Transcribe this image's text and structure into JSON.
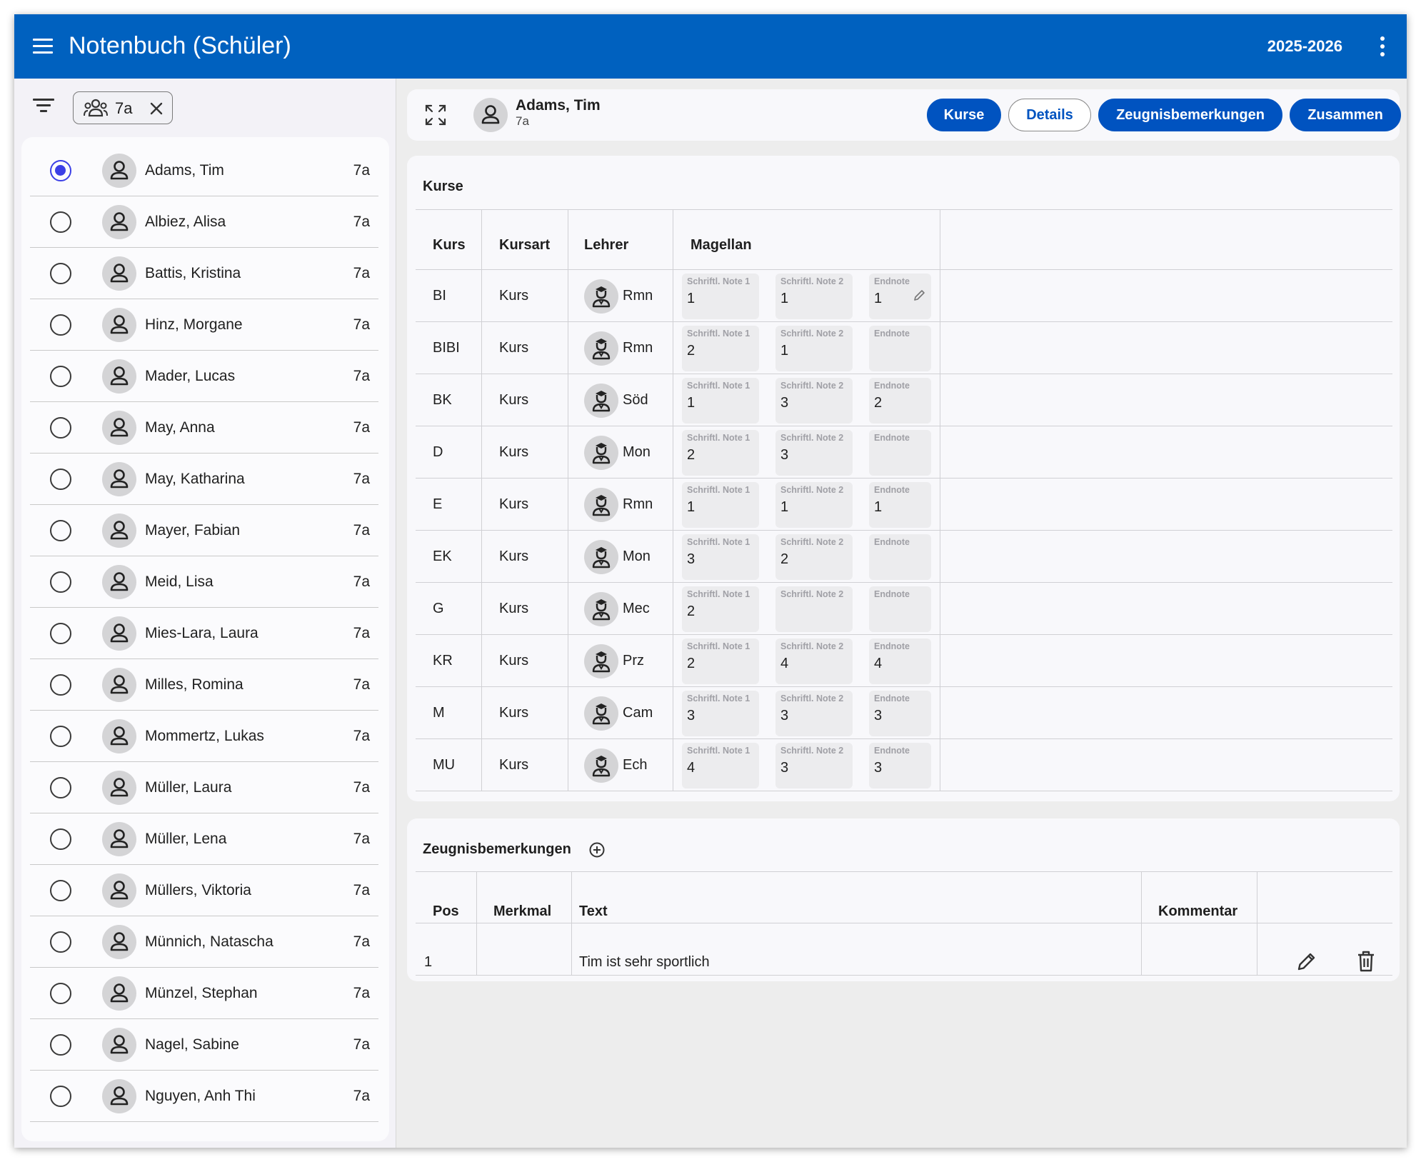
{
  "app": {
    "title": "Notenbuch (Schüler)",
    "school_year": "2025-2026",
    "menu_icon": "menu-icon",
    "more_icon": "more-vert-icon"
  },
  "filter": {
    "icon": "filter-icon",
    "chip": {
      "icon": "group-icon",
      "label": "7a",
      "remove_icon": "close-icon"
    }
  },
  "students": [
    {
      "name": "Adams, Tim",
      "class": "7a",
      "selected": true
    },
    {
      "name": "Albiez, Alisa",
      "class": "7a",
      "selected": false
    },
    {
      "name": "Battis, Kristina",
      "class": "7a",
      "selected": false
    },
    {
      "name": "Hinz, Morgane",
      "class": "7a",
      "selected": false
    },
    {
      "name": "Mader, Lucas",
      "class": "7a",
      "selected": false
    },
    {
      "name": "May, Anna",
      "class": "7a",
      "selected": false
    },
    {
      "name": "May, Katharina",
      "class": "7a",
      "selected": false
    },
    {
      "name": "Mayer, Fabian",
      "class": "7a",
      "selected": false
    },
    {
      "name": "Meid, Lisa",
      "class": "7a",
      "selected": false
    },
    {
      "name": "Mies-Lara, Laura",
      "class": "7a",
      "selected": false
    },
    {
      "name": "Milles, Romina",
      "class": "7a",
      "selected": false
    },
    {
      "name": "Mommertz, Lukas",
      "class": "7a",
      "selected": false
    },
    {
      "name": "Müller, Laura",
      "class": "7a",
      "selected": false
    },
    {
      "name": "Müller, Lena",
      "class": "7a",
      "selected": false
    },
    {
      "name": "Müllers, Viktoria",
      "class": "7a",
      "selected": false
    },
    {
      "name": "Münnich, Natascha",
      "class": "7a",
      "selected": false
    },
    {
      "name": "Münzel, Stephan",
      "class": "7a",
      "selected": false
    },
    {
      "name": "Nagel, Sabine",
      "class": "7a",
      "selected": false
    },
    {
      "name": "Nguyen, Anh Thi",
      "class": "7a",
      "selected": false
    }
  ],
  "header": {
    "student_name": "Adams, Tim",
    "student_class": "7a",
    "expand_icon": "expand-icon",
    "buttons": [
      {
        "label": "Kurse",
        "style": "filled"
      },
      {
        "label": "Details",
        "style": "outline"
      },
      {
        "label": "Zeugnisbemerkungen",
        "style": "filled"
      },
      {
        "label": "Zusammen",
        "style": "filled"
      }
    ]
  },
  "courses": {
    "title": "Kurse",
    "columns": [
      "Kurs",
      "Kursart",
      "Lehrer",
      "Magellan"
    ],
    "grade_labels": [
      "Schriftl. Note 1",
      "Schriftl. Note 2",
      "Endnote"
    ],
    "rows": [
      {
        "kurs": "BI",
        "kursart": "Kurs",
        "lehrer": "Rmn",
        "note1": "1",
        "note2": "1",
        "endnote": "1",
        "editing": true
      },
      {
        "kurs": "BIBI",
        "kursart": "Kurs",
        "lehrer": "Rmn",
        "note1": "2",
        "note2": "1",
        "endnote": ""
      },
      {
        "kurs": "BK",
        "kursart": "Kurs",
        "lehrer": "Söd",
        "note1": "1",
        "note2": "3",
        "endnote": "2"
      },
      {
        "kurs": "D",
        "kursart": "Kurs",
        "lehrer": "Mon",
        "note1": "2",
        "note2": "3",
        "endnote": ""
      },
      {
        "kurs": "E",
        "kursart": "Kurs",
        "lehrer": "Rmn",
        "note1": "1",
        "note2": "1",
        "endnote": "1"
      },
      {
        "kurs": "EK",
        "kursart": "Kurs",
        "lehrer": "Mon",
        "note1": "3",
        "note2": "2",
        "endnote": ""
      },
      {
        "kurs": "G",
        "kursart": "Kurs",
        "lehrer": "Mec",
        "note1": "2",
        "note2": "",
        "endnote": ""
      },
      {
        "kurs": "KR",
        "kursart": "Kurs",
        "lehrer": "Prz",
        "note1": "2",
        "note2": "4",
        "endnote": "4"
      },
      {
        "kurs": "M",
        "kursart": "Kurs",
        "lehrer": "Cam",
        "note1": "3",
        "note2": "3",
        "endnote": "3"
      },
      {
        "kurs": "MU",
        "kursart": "Kurs",
        "lehrer": "Ech",
        "note1": "4",
        "note2": "3",
        "endnote": "3"
      }
    ]
  },
  "remarks": {
    "title": "Zeugnisbemerkungen",
    "add_icon": "add-circle-icon",
    "columns": [
      "Pos",
      "Merkmal",
      "Text",
      "Kommentar"
    ],
    "rows": [
      {
        "pos": "1",
        "merkmal": "",
        "text": "Tim ist sehr sportlich",
        "kommentar": "",
        "edit_icon": "pencil-icon",
        "delete_icon": "trash-icon"
      }
    ]
  },
  "colors": {
    "primary": "#0061bf",
    "button": "#0053c0",
    "radio_selected": "#3b3fe6",
    "background": "#ededed"
  }
}
